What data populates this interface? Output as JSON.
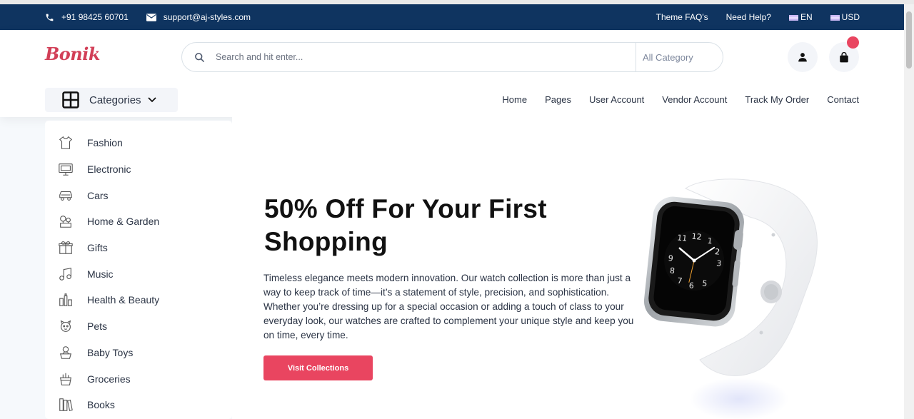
{
  "topbar": {
    "phone": "+91 98425 60701",
    "email": "support@aj-styles.com",
    "links": [
      "Theme FAQ's",
      "Need Help?"
    ],
    "language": "EN",
    "currency": "USD"
  },
  "header": {
    "logo": "Bonik",
    "search_placeholder": "Search and hit enter...",
    "category_select": "All Category"
  },
  "categories_button": "Categories",
  "nav": [
    "Home",
    "Pages",
    "User Account",
    "Vendor Account",
    "Track My Order",
    "Contact"
  ],
  "sidebar": {
    "items": [
      {
        "label": "Fashion",
        "icon": "fashion-icon"
      },
      {
        "label": "Electronic",
        "icon": "electronic-icon"
      },
      {
        "label": "Cars",
        "icon": "car-icon"
      },
      {
        "label": "Home & Garden",
        "icon": "home-garden-icon"
      },
      {
        "label": "Gifts",
        "icon": "gift-icon"
      },
      {
        "label": "Music",
        "icon": "music-icon"
      },
      {
        "label": "Health & Beauty",
        "icon": "health-beauty-icon"
      },
      {
        "label": "Pets",
        "icon": "pet-icon"
      },
      {
        "label": "Baby Toys",
        "icon": "baby-toys-icon"
      },
      {
        "label": "Groceries",
        "icon": "groceries-icon"
      },
      {
        "label": "Books",
        "icon": "books-icon"
      }
    ]
  },
  "hero": {
    "title": "50% Off For Your First Shopping",
    "body": "Timeless elegance meets modern innovation. Our watch collection is more than just a way to keep track of time—it’s a statement of style, precision, and sophistication. Whether you’re dressing up for a special occasion or adding a touch of class to your everyday look, our watches are crafted to complement your unique style and keep you on time, every time.",
    "button": "Visit Collections",
    "watch_numerals": [
      "11",
      "12",
      "1",
      "2",
      "3",
      "5",
      "6",
      "7",
      "8",
      "9"
    ]
  },
  "colors": {
    "topbar": "#0f3460",
    "brand": "#d23f57",
    "accent": "#e94560"
  }
}
